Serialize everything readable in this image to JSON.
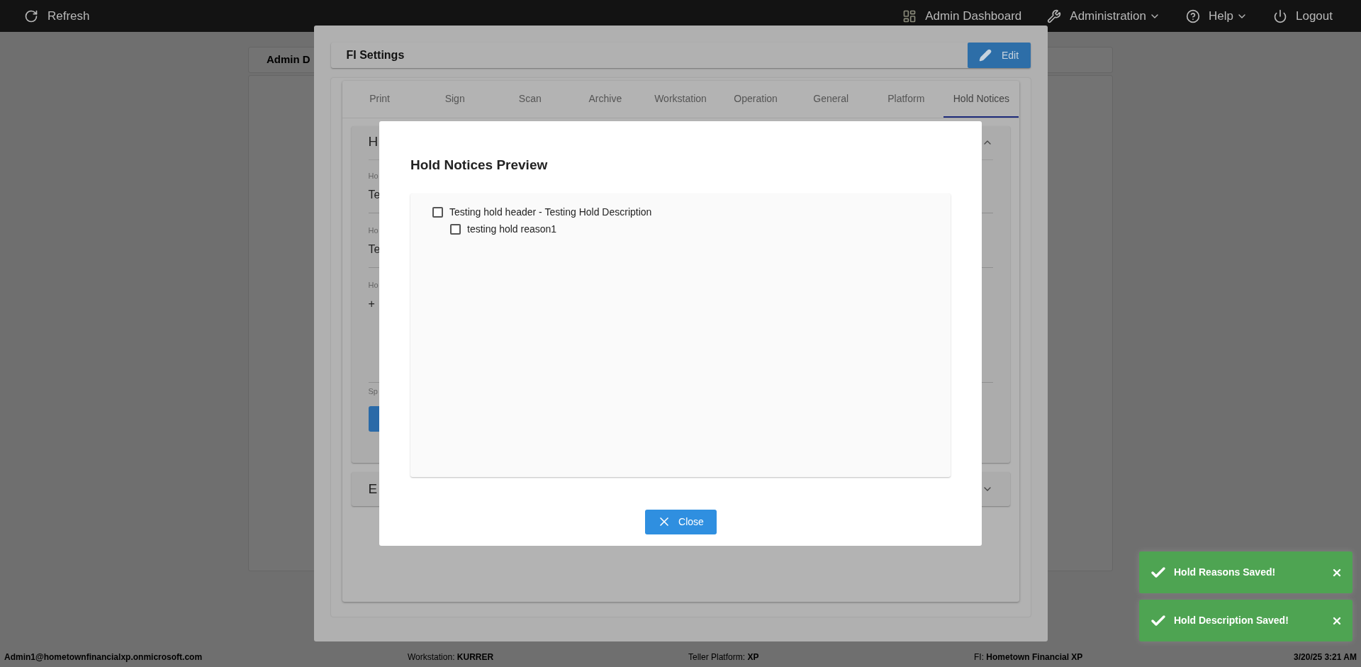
{
  "topbar": {
    "refresh": "Refresh",
    "menu": [
      {
        "kind": "dashboard",
        "label": "Admin Dashboard",
        "dropdown": false
      },
      {
        "kind": "wrench",
        "label": "Administration",
        "dropdown": true
      },
      {
        "kind": "help",
        "label": "Help",
        "dropdown": true
      },
      {
        "kind": "power",
        "label": "Logout",
        "dropdown": false
      }
    ]
  },
  "page": {
    "card_title": "Admin D"
  },
  "fi_settings": {
    "title": "FI Settings",
    "edit_button": "Edit",
    "tabs": [
      {
        "label": "Print",
        "selected": false
      },
      {
        "label": "Sign",
        "selected": false
      },
      {
        "label": "Scan",
        "selected": false
      },
      {
        "label": "Archive",
        "selected": false
      },
      {
        "label": "Workstation",
        "selected": false
      },
      {
        "label": "Operation",
        "selected": false
      },
      {
        "label": "General",
        "selected": false
      },
      {
        "label": "Platform",
        "selected": false
      },
      {
        "label": "Hold Notices",
        "selected": true
      }
    ],
    "panel": {
      "title": "H",
      "fields": [
        {
          "label": "Ho",
          "value": "Te"
        },
        {
          "label": "Ho",
          "value": "Te"
        },
        {
          "label": "Ho",
          "value": "+"
        }
      ],
      "helper": "Sp"
    },
    "panel2_title": "E"
  },
  "dialog": {
    "title": "Hold Notices Preview",
    "tree": [
      {
        "label": "Testing hold header - Testing Hold Description",
        "checked": false,
        "children": [
          {
            "label": "testing hold reason1",
            "checked": false
          }
        ]
      }
    ],
    "close_button": "Close"
  },
  "toasts": [
    {
      "message": "Hold Reasons Saved!"
    },
    {
      "message": "Hold Description Saved!"
    }
  ],
  "status_bar": {
    "user": "Admin1@hometownfinancialxp.onmicrosoft.com",
    "fields": [
      {
        "label": "Workstation:",
        "value": "KURRER"
      },
      {
        "label": "Teller Platform:",
        "value": "XP"
      },
      {
        "label": "FI:",
        "value": "Hometown Financial XP"
      }
    ],
    "datetime": "3/20/25 3:21 AM"
  }
}
